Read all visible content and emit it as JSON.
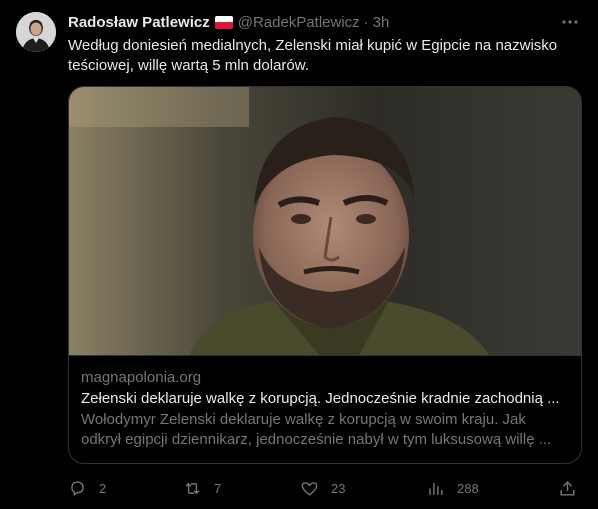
{
  "author": {
    "display_name": "Radosław Patlewicz",
    "handle": "@RadekPatlewicz",
    "separator": "·",
    "time": "3h",
    "flag_icon": "poland-flag-icon"
  },
  "tweet": {
    "text_line1": "Według doniesień medialnych, Zelenski miał kupić w Egipcie na nazwisko",
    "text_line2": "teściowej, willę wartą 5 mln dolarów."
  },
  "card": {
    "domain": "magnapolonia.org",
    "title": "Zełenski deklaruje walkę z korupcją. Jednocześnie kradnie zachodnią ...",
    "desc_line1": "Wołodymyr Zelenski deklaruje walkę z korupcją w swoim kraju. Jak",
    "desc_line2": "odkrył egipcji dziennikarz, jednocześnie nabył w tym luksusową willę ..."
  },
  "actions": {
    "replies": "2",
    "retweets": "7",
    "likes": "23",
    "views": "288"
  },
  "colors": {
    "background": "#000000",
    "text": "#e7e9ea",
    "muted": "#71767b",
    "border": "#2f3336"
  }
}
